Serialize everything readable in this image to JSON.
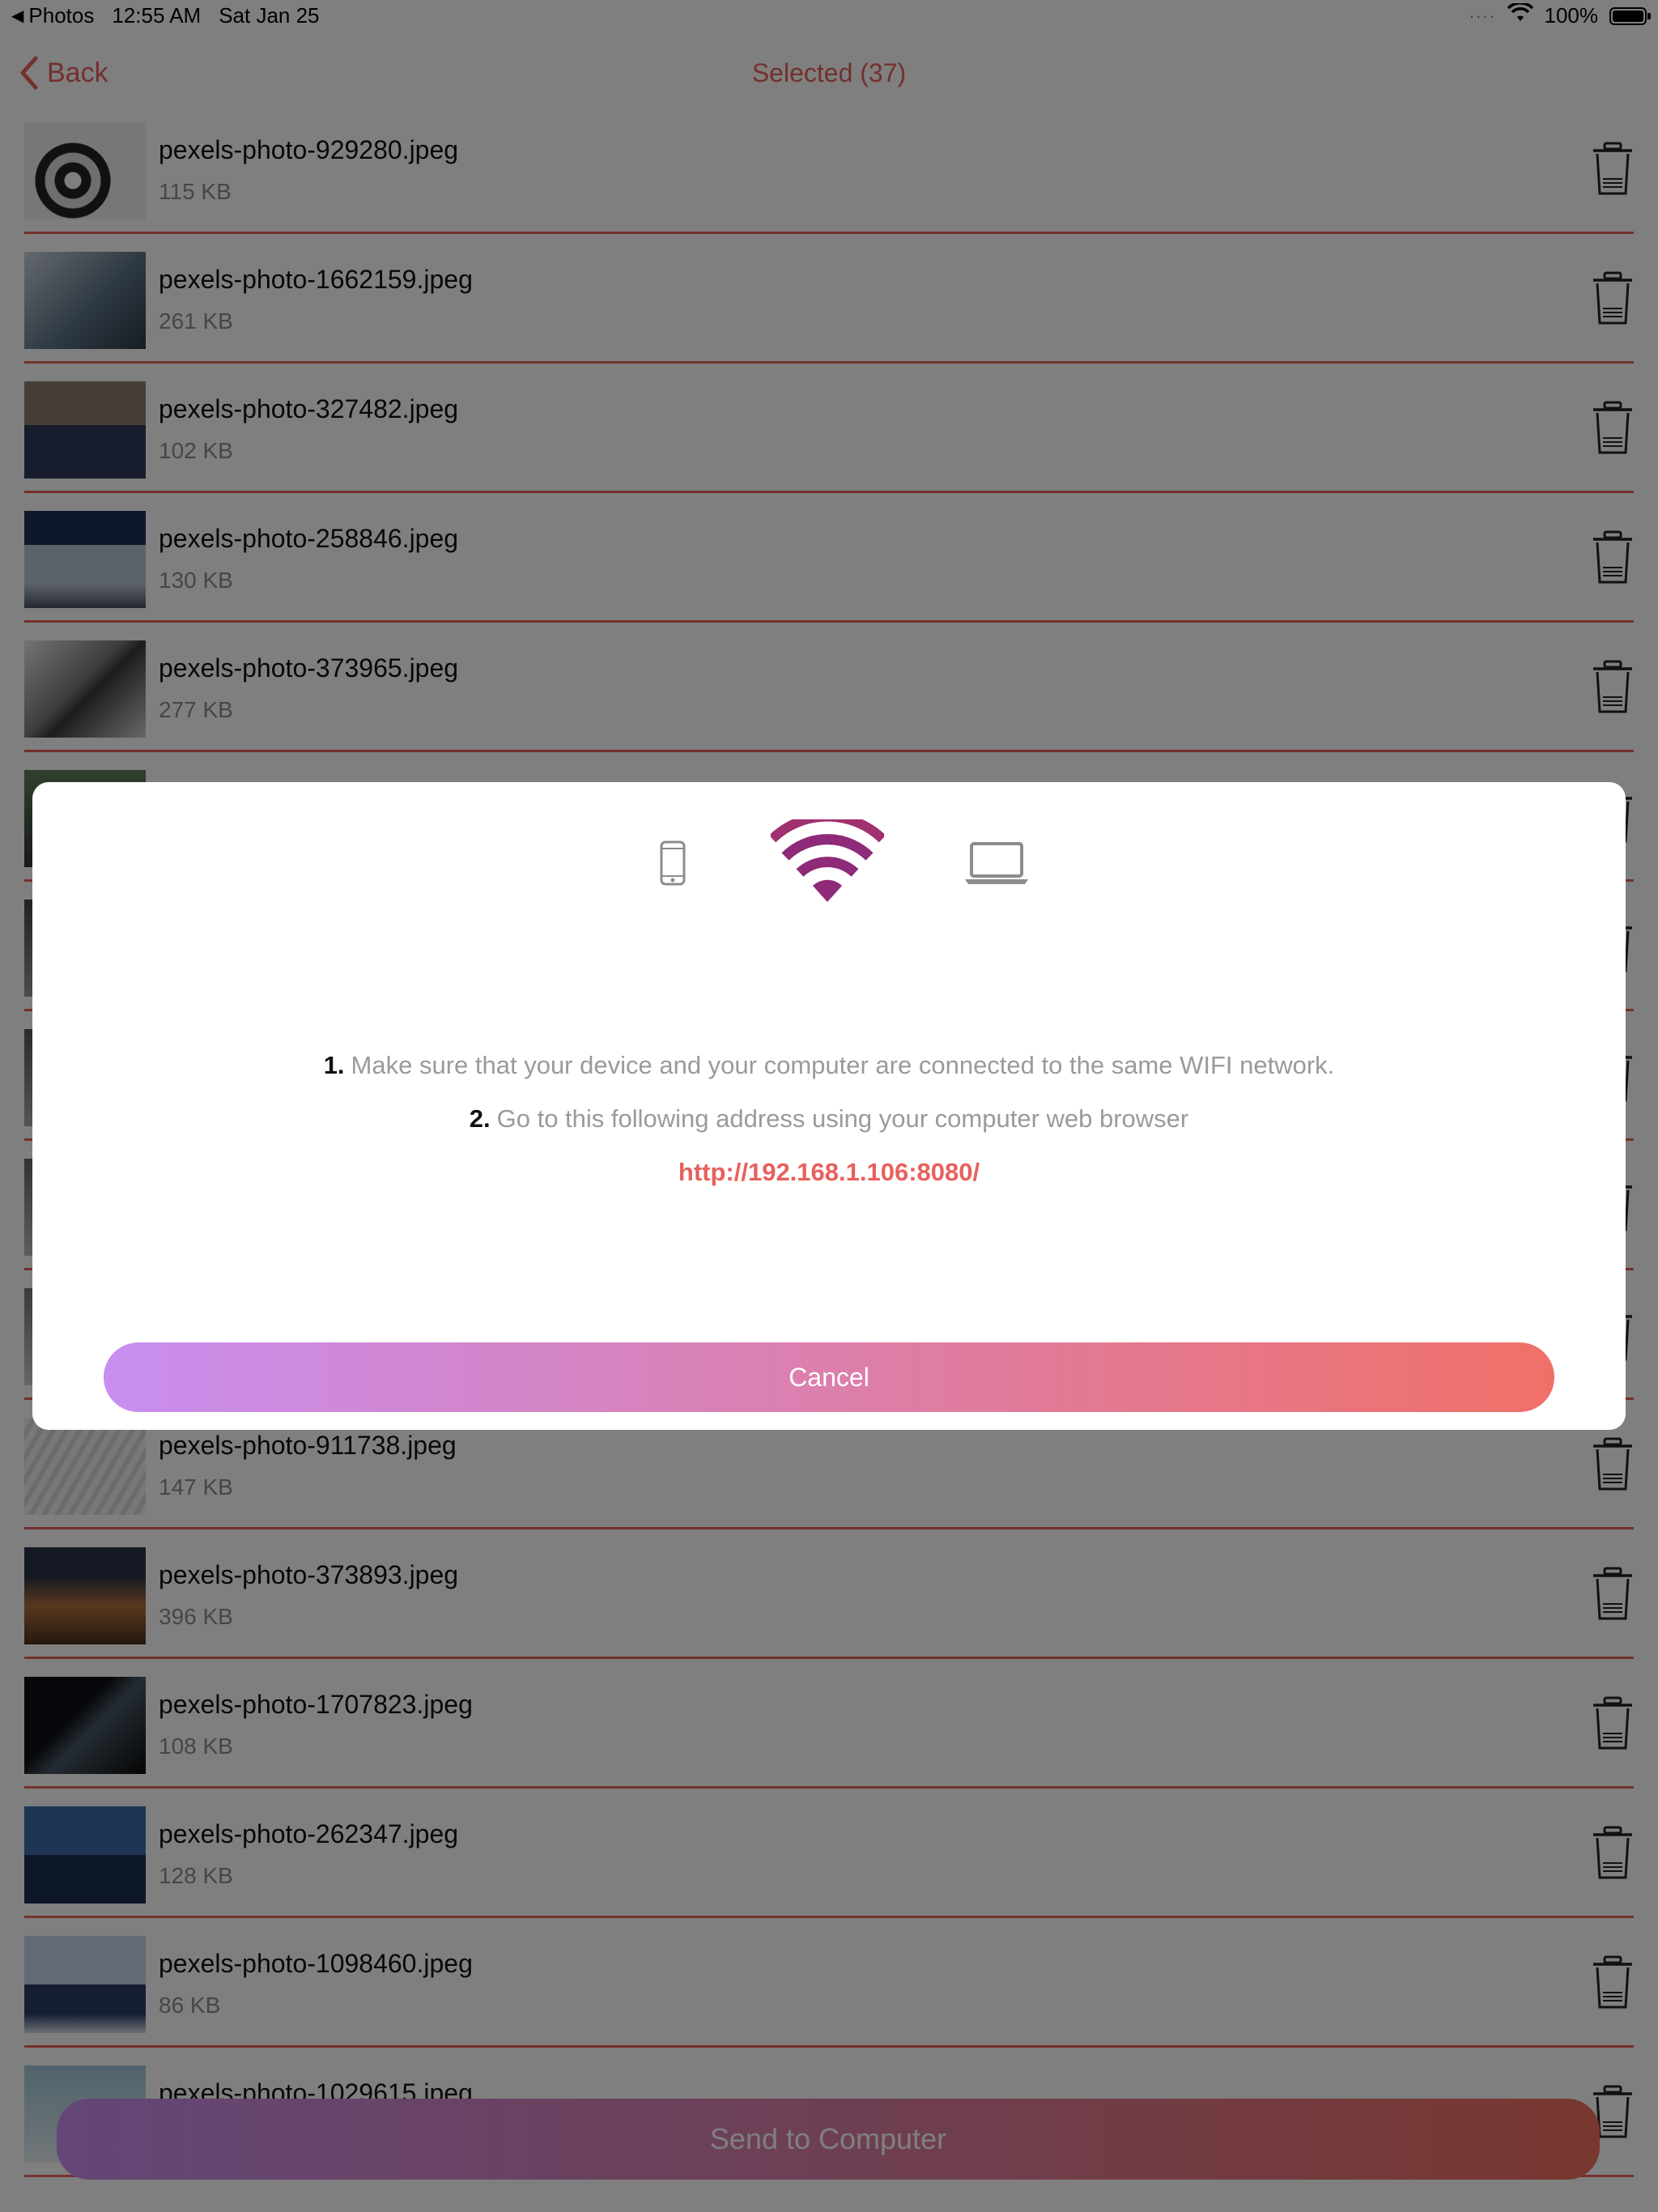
{
  "status_bar": {
    "back_app": "Photos",
    "time": "12:55 AM",
    "date": "Sat Jan 25",
    "battery": "100%",
    "battery_level": 1.0
  },
  "nav": {
    "back_label": "Back",
    "title": "Selected (37)"
  },
  "files": [
    {
      "name": "pexels-photo-929280.jpeg",
      "size": "115 KB"
    },
    {
      "name": "pexels-photo-1662159.jpeg",
      "size": "261 KB"
    },
    {
      "name": "pexels-photo-327482.jpeg",
      "size": "102 KB"
    },
    {
      "name": "pexels-photo-258846.jpeg",
      "size": "130 KB"
    },
    {
      "name": "pexels-photo-373965.jpeg",
      "size": "277 KB"
    },
    {
      "name": "",
      "size": ""
    },
    {
      "name": "",
      "size": ""
    },
    {
      "name": "",
      "size": ""
    },
    {
      "name": "",
      "size": ""
    },
    {
      "name": "",
      "size": ""
    },
    {
      "name": "pexels-photo-911738.jpeg",
      "size": "147 KB"
    },
    {
      "name": "pexels-photo-373893.jpeg",
      "size": "396 KB"
    },
    {
      "name": "pexels-photo-1707823.jpeg",
      "size": "108 KB"
    },
    {
      "name": "pexels-photo-262347.jpeg",
      "size": "128 KB"
    },
    {
      "name": "pexels-photo-1098460.jpeg",
      "size": "86 KB"
    },
    {
      "name": "pexels-photo-1029615.jpeg",
      "size": ""
    }
  ],
  "send_button": "Send to Computer",
  "modal": {
    "icons": [
      "phone-icon",
      "wifi-icon",
      "laptop-icon"
    ],
    "step1_num": "1.",
    "step1_text": "Make sure that your device and your computer are connected to the same WIFI network.",
    "step2_num": "2.",
    "step2_text": "Go to this following address using your computer web browser",
    "address": "http://192.168.1.106:8080/",
    "cancel_label": "Cancel"
  },
  "colors": {
    "accent": "#e8605d",
    "gradient_start": "#c88ef0",
    "gradient_end": "#f07060",
    "wifi": "#8e2a78"
  }
}
